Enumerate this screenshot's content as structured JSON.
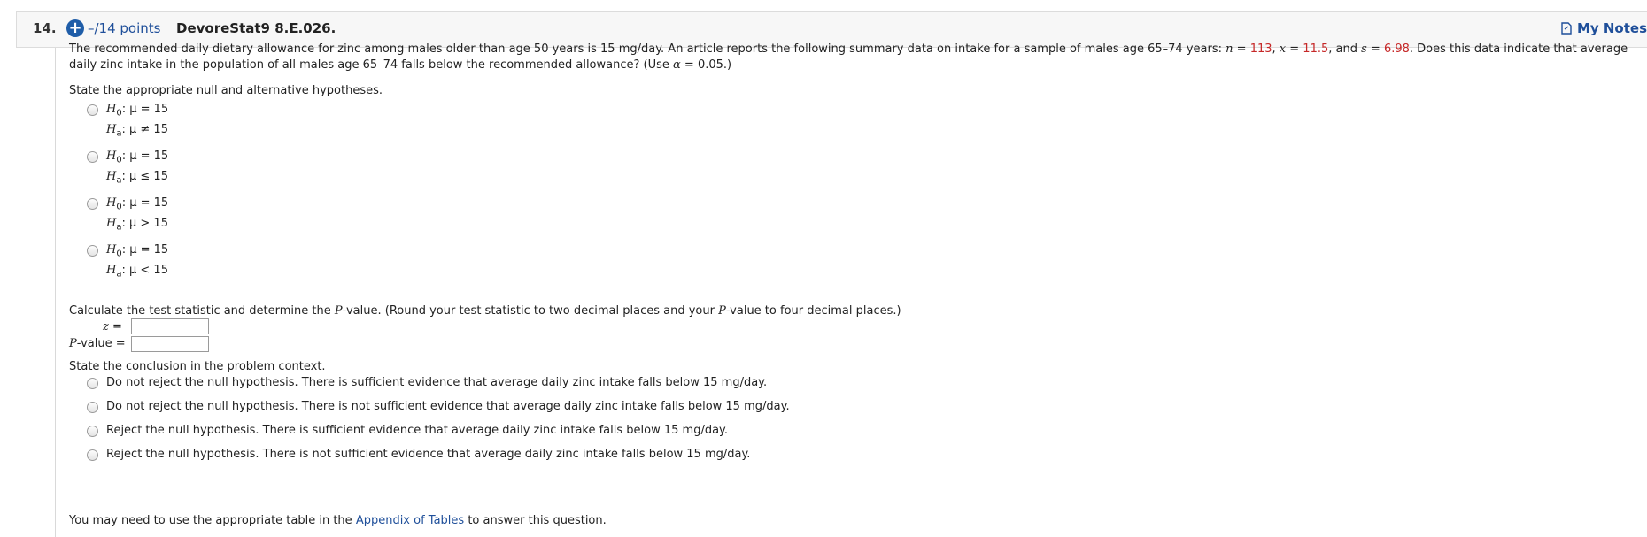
{
  "header": {
    "number": "14.",
    "points": "–/14 points",
    "code": "DevoreStat9 8.E.026.",
    "my_notes": "My Notes"
  },
  "problem": {
    "part1": "The recommended daily dietary allowance for zinc among males older than age 50 years is 15 mg/day. An article reports the following summary data on intake for a sample of males age 65–74 years: ",
    "n_label": "n",
    "n_eq": " = ",
    "n_val": "113",
    "sep1": ", ",
    "x_label": "x",
    "x_eq": " = ",
    "x_val": "11.5",
    "sep2": ", and ",
    "s_label": "s",
    "s_eq": " = ",
    "s_val": "6.98",
    "part2": ". Does this data indicate that average daily zinc intake in the population of all males age 65–74 falls below the recommended allowance? (Use ",
    "alpha": "α",
    "alpha_eq": " = 0.05.)"
  },
  "hypotheses_prompt": "State the appropriate null and alternative hypotheses.",
  "hypothesis_options": [
    {
      "h0": ": μ = 15",
      "ha": ": μ ≠ 15"
    },
    {
      "h0": ": μ = 15",
      "ha": ": μ ≤ 15"
    },
    {
      "h0": ": μ = 15",
      "ha": ": μ > 15"
    },
    {
      "h0": ": μ = 15",
      "ha": ": μ < 15"
    }
  ],
  "h_symbol": "H",
  "h0_sub": "0",
  "ha_sub": "a",
  "calc": {
    "prompt_1": "Calculate the test statistic and determine the ",
    "prompt_p": "P",
    "prompt_2": "-value. (Round your test statistic to two decimal places and your ",
    "prompt_p2": "P",
    "prompt_3": "-value to four decimal places.)",
    "z_label": "z",
    "z_eq": " =",
    "p_label": "P",
    "p_rest": "-value",
    "p_eq": " =",
    "z_value": "",
    "p_value": ""
  },
  "conclusion_prompt": "State the conclusion in the problem context.",
  "conclusion_options": [
    "Do not reject the null hypothesis. There is sufficient evidence that average daily zinc intake falls below 15 mg/day.",
    "Do not reject the null hypothesis. There is not sufficient evidence that average daily zinc intake falls below 15 mg/day.",
    "Reject the null hypothesis. There is sufficient evidence that average daily zinc intake falls below 15 mg/day.",
    "Reject the null hypothesis. There is not sufficient evidence that average daily zinc intake falls below 15 mg/day."
  ],
  "footer": {
    "pre": "You may need to use the appropriate table in the ",
    "link": "Appendix of Tables",
    "post": " to answer this question."
  },
  "colors": {
    "accent": "#1f5da8",
    "link": "#1f4f9a",
    "given_values": "#c62828"
  },
  "icons": {
    "add": "plus-circle-icon",
    "notes": "note-document-icon"
  }
}
